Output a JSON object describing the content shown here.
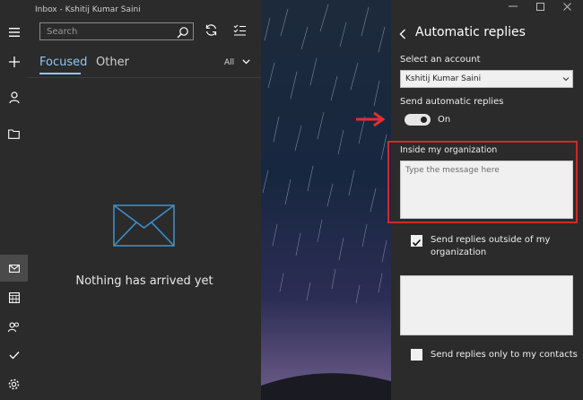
{
  "window": {
    "title": "Inbox - Kshitij Kumar Saini"
  },
  "rail": {
    "icons": [
      "hamburger-menu-icon",
      "compose-plus-icon",
      "account-person-icon",
      "folder-icon",
      "mail-icon",
      "calendar-icon",
      "people-icon",
      "todo-checkmark-icon",
      "settings-gear-icon"
    ]
  },
  "search": {
    "placeholder": "Search"
  },
  "tabs": {
    "focused": "Focused",
    "other": "Other",
    "filter": "All"
  },
  "message_list": {
    "empty_text": "Nothing has arrived yet"
  },
  "auto_replies": {
    "title": "Automatic replies",
    "select_account_label": "Select an account",
    "account": "Kshitij Kumar Saini",
    "send_label": "Send automatic replies",
    "toggle_state": "On",
    "toggle_on": true,
    "inside_label": "Inside my organization",
    "inside_placeholder": "Type the message here",
    "outside_checkbox_label_1": "Send replies outside of my",
    "outside_checkbox_label_2": "organization",
    "outside_checked": true,
    "contacts_only_label": "Send replies only to my contacts",
    "contacts_only_checked": false
  },
  "colors": {
    "accent": "#8ec8f0",
    "highlight": "#d0282d",
    "arrow": "#e03030"
  }
}
